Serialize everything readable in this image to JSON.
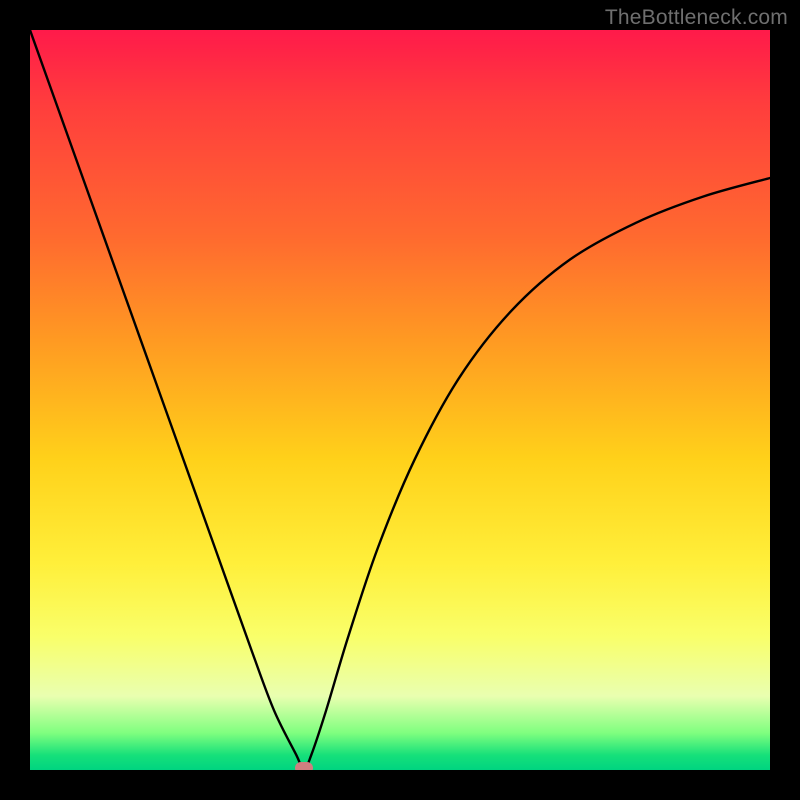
{
  "watermark": "TheBottleneck.com",
  "chart_data": {
    "type": "line",
    "title": "",
    "xlabel": "",
    "ylabel": "",
    "xlim": [
      0,
      100
    ],
    "ylim": [
      0,
      100
    ],
    "grid": false,
    "legend": false,
    "series": [
      {
        "name": "curve",
        "x": [
          0,
          5,
          10,
          15,
          20,
          25,
          30,
          33,
          36,
          37,
          38,
          40,
          43,
          47,
          52,
          58,
          65,
          73,
          82,
          91,
          100
        ],
        "y": [
          100,
          86,
          72,
          58,
          44,
          30,
          16,
          8,
          2,
          0,
          2,
          8,
          18,
          30,
          42,
          53,
          62,
          69,
          74,
          77.5,
          80
        ]
      }
    ],
    "marker": {
      "x": 37,
      "y": 0
    },
    "background_gradient": {
      "stops": [
        {
          "pos": 0,
          "color": "#ff1a4a"
        },
        {
          "pos": 10,
          "color": "#ff3d3d"
        },
        {
          "pos": 28,
          "color": "#ff6a2f"
        },
        {
          "pos": 42,
          "color": "#ff9a22"
        },
        {
          "pos": 58,
          "color": "#ffd11a"
        },
        {
          "pos": 72,
          "color": "#ffef3a"
        },
        {
          "pos": 82,
          "color": "#f9ff6a"
        },
        {
          "pos": 90,
          "color": "#e9ffb0"
        },
        {
          "pos": 95,
          "color": "#7fff7f"
        },
        {
          "pos": 98,
          "color": "#16e07a"
        },
        {
          "pos": 100,
          "color": "#00d480"
        }
      ]
    }
  }
}
